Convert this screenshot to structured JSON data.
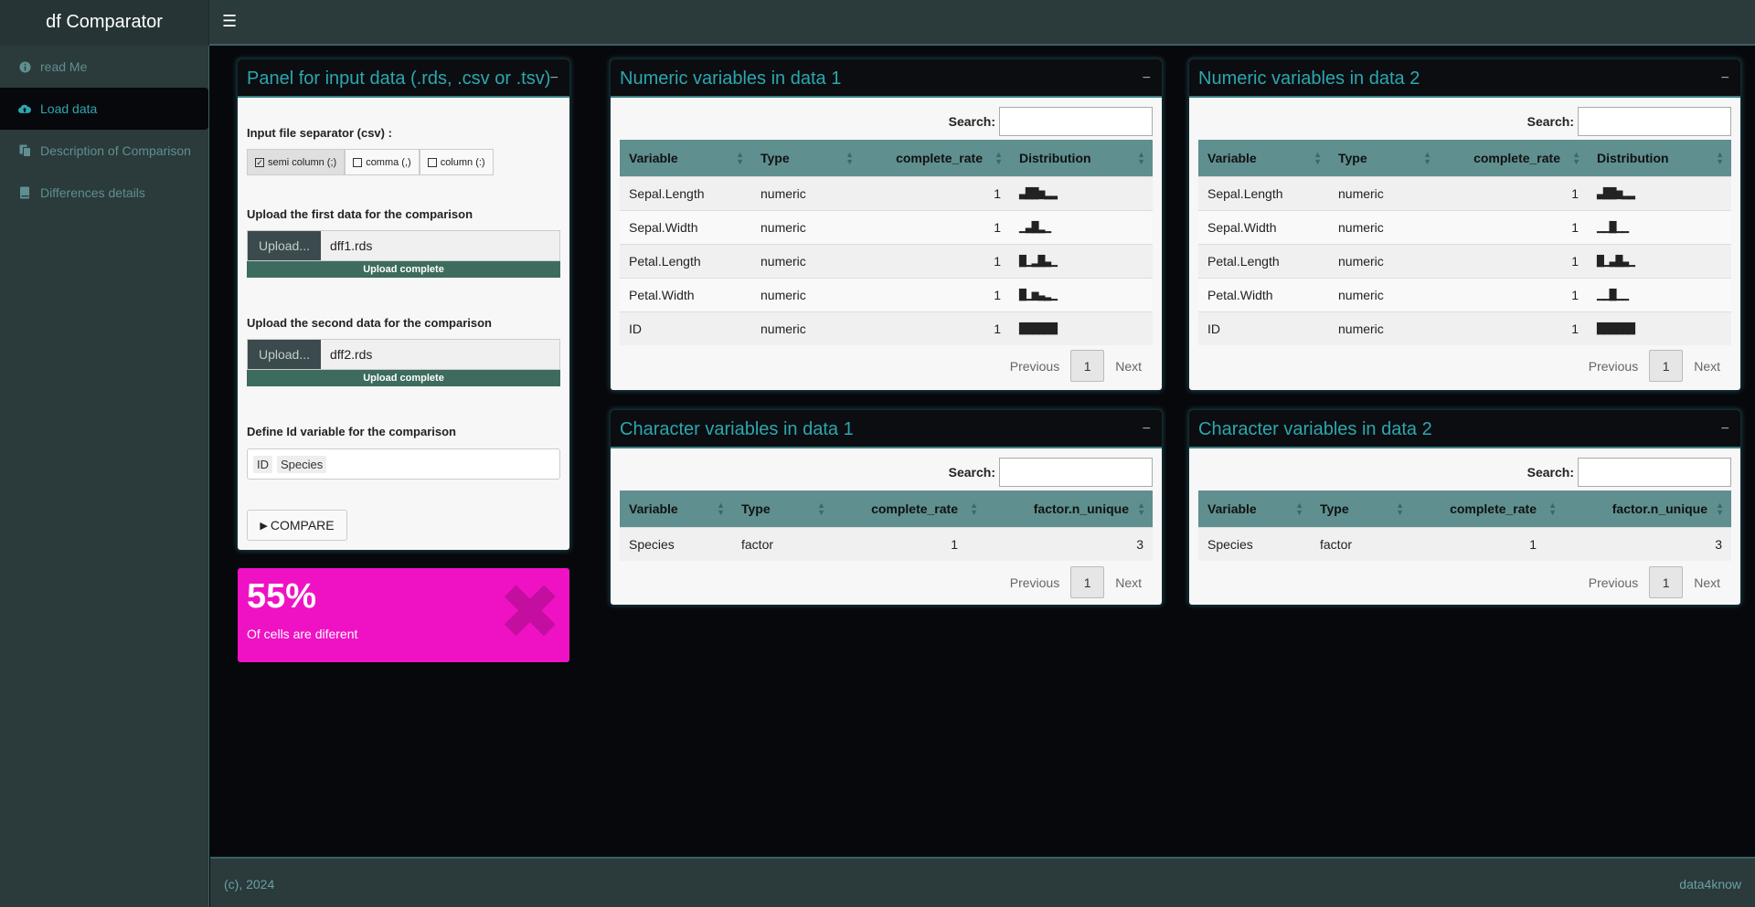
{
  "app": {
    "title": "df Comparator",
    "menu_icon": "hamburger-icon"
  },
  "sidebar": {
    "items": [
      {
        "label": "read Me",
        "icon": "info-icon"
      },
      {
        "label": "Load data",
        "icon": "cloud-upload-icon"
      },
      {
        "label": "Description of Comparison",
        "icon": "copy-icon"
      },
      {
        "label": "Differences details",
        "icon": "book-icon"
      }
    ]
  },
  "input_panel": {
    "title": "Panel for input data (.rds, .csv or .tsv)",
    "separator_label": "Input file separator (csv) :",
    "separators": [
      "semi column (;)",
      "comma (,)",
      "column (:)"
    ],
    "first_label": "Upload the first data for the comparison",
    "upload_button": "Upload...",
    "first_file": "dff1.rds",
    "upload_status": "Upload complete",
    "second_label": "Upload the second data for the comparison",
    "second_file": "dff2.rds",
    "id_label": "Define Id variable for the comparison",
    "id_tags": [
      "ID",
      "Species"
    ],
    "compare_button": "COMPARE"
  },
  "info_box": {
    "value": "55%",
    "text": "Of cells are diferent",
    "accent": "#ef12c4"
  },
  "search_label": "Search:",
  "pager": {
    "previous": "Previous",
    "page": "1",
    "next": "Next"
  },
  "numeric1": {
    "title": "Numeric variables in data 1",
    "headers": [
      "Variable",
      "Type",
      "complete_rate",
      "Distribution"
    ],
    "rows": [
      [
        "Sepal.Length",
        "numeric",
        "1",
        "▃▇▇▅▂▂"
      ],
      [
        "Sepal.Width",
        "numeric",
        "1",
        "▁▃▇▂▁"
      ],
      [
        "Petal.Length",
        "numeric",
        "1",
        "▇▁▂▇▃▁"
      ],
      [
        "Petal.Width",
        "numeric",
        "1",
        "▇▁▅▃▂▁"
      ],
      [
        "ID",
        "numeric",
        "1",
        "▇▇▇▇▇▇"
      ]
    ]
  },
  "numeric2": {
    "title": "Numeric variables in data 2",
    "headers": [
      "Variable",
      "Type",
      "complete_rate",
      "Distribution"
    ],
    "rows": [
      [
        "Sepal.Length",
        "numeric",
        "1",
        "▃▇▇▅▂▂"
      ],
      [
        "Sepal.Width",
        "numeric",
        "1",
        "▁▁▇▁▁"
      ],
      [
        "Petal.Length",
        "numeric",
        "1",
        "▇▁▃▇▃▁"
      ],
      [
        "Petal.Width",
        "numeric",
        "1",
        "▁▁▇▁▁"
      ],
      [
        "ID",
        "numeric",
        "1",
        "▇▇▇▇▇▇"
      ]
    ]
  },
  "char1": {
    "title": "Character variables in data 1",
    "headers": [
      "Variable",
      "Type",
      "complete_rate",
      "factor.n_unique"
    ],
    "rows": [
      [
        "Species",
        "factor",
        "1",
        "3"
      ]
    ]
  },
  "char2": {
    "title": "Character variables in data 2",
    "headers": [
      "Variable",
      "Type",
      "complete_rate",
      "factor.n_unique"
    ],
    "rows": [
      [
        "Species",
        "factor",
        "1",
        "3"
      ]
    ]
  },
  "footer": {
    "left": "(c), 2024",
    "right": "data4know"
  }
}
